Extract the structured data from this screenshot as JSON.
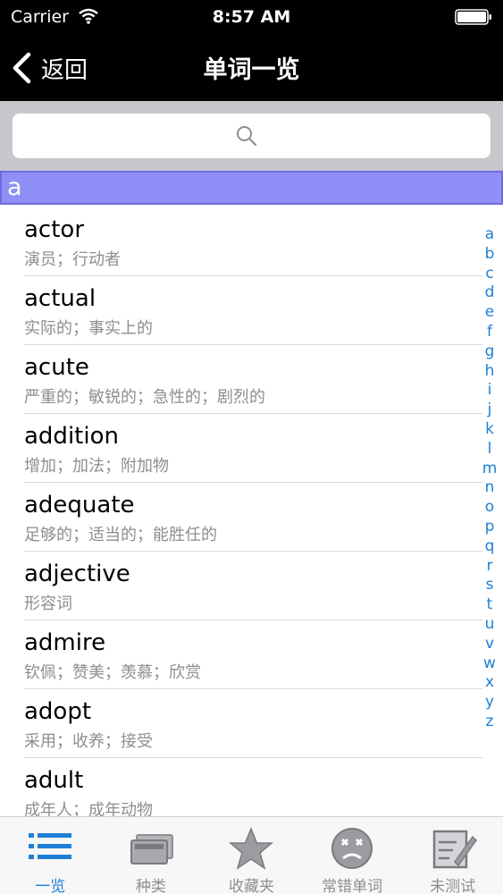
{
  "status": {
    "carrier": "Carrier",
    "time": "8:57 AM"
  },
  "nav": {
    "back_label": "返回",
    "title": "单词一览"
  },
  "search": {
    "placeholder": ""
  },
  "section": {
    "letter": "a"
  },
  "words": [
    {
      "word": "actor",
      "meaning": "演员；行动者"
    },
    {
      "word": "actual",
      "meaning": "实际的；事实上的"
    },
    {
      "word": "acute",
      "meaning": "严重的；敏锐的；急性的；剧烈的"
    },
    {
      "word": "addition",
      "meaning": "增加；加法；附加物"
    },
    {
      "word": "adequate",
      "meaning": "足够的；适当的；能胜任的"
    },
    {
      "word": "adjective",
      "meaning": "形容词"
    },
    {
      "word": "admire",
      "meaning": "钦佩；赞美；羡慕；欣赏"
    },
    {
      "word": "adopt",
      "meaning": "采用；收养；接受"
    },
    {
      "word": "adult",
      "meaning": "成年人；成年动物"
    }
  ],
  "index": [
    "a",
    "b",
    "c",
    "d",
    "e",
    "f",
    "g",
    "h",
    "i",
    "j",
    "k",
    "l",
    "m",
    "n",
    "o",
    "p",
    "q",
    "r",
    "s",
    "t",
    "u",
    "v",
    "w",
    "x",
    "y",
    "z"
  ],
  "tabs": [
    {
      "label": "一览",
      "icon": "list-icon",
      "active": true
    },
    {
      "label": "种类",
      "icon": "cards-icon",
      "active": false
    },
    {
      "label": "收藏夹",
      "icon": "star-icon",
      "active": false
    },
    {
      "label": "常错单词",
      "icon": "sad-face-icon",
      "active": false
    },
    {
      "label": "未测试",
      "icon": "edit-icon",
      "active": false
    }
  ],
  "colors": {
    "accent": "#1e7fd6",
    "section_bg": "#8f8ff7",
    "tab_inactive": "#8e8e93"
  }
}
